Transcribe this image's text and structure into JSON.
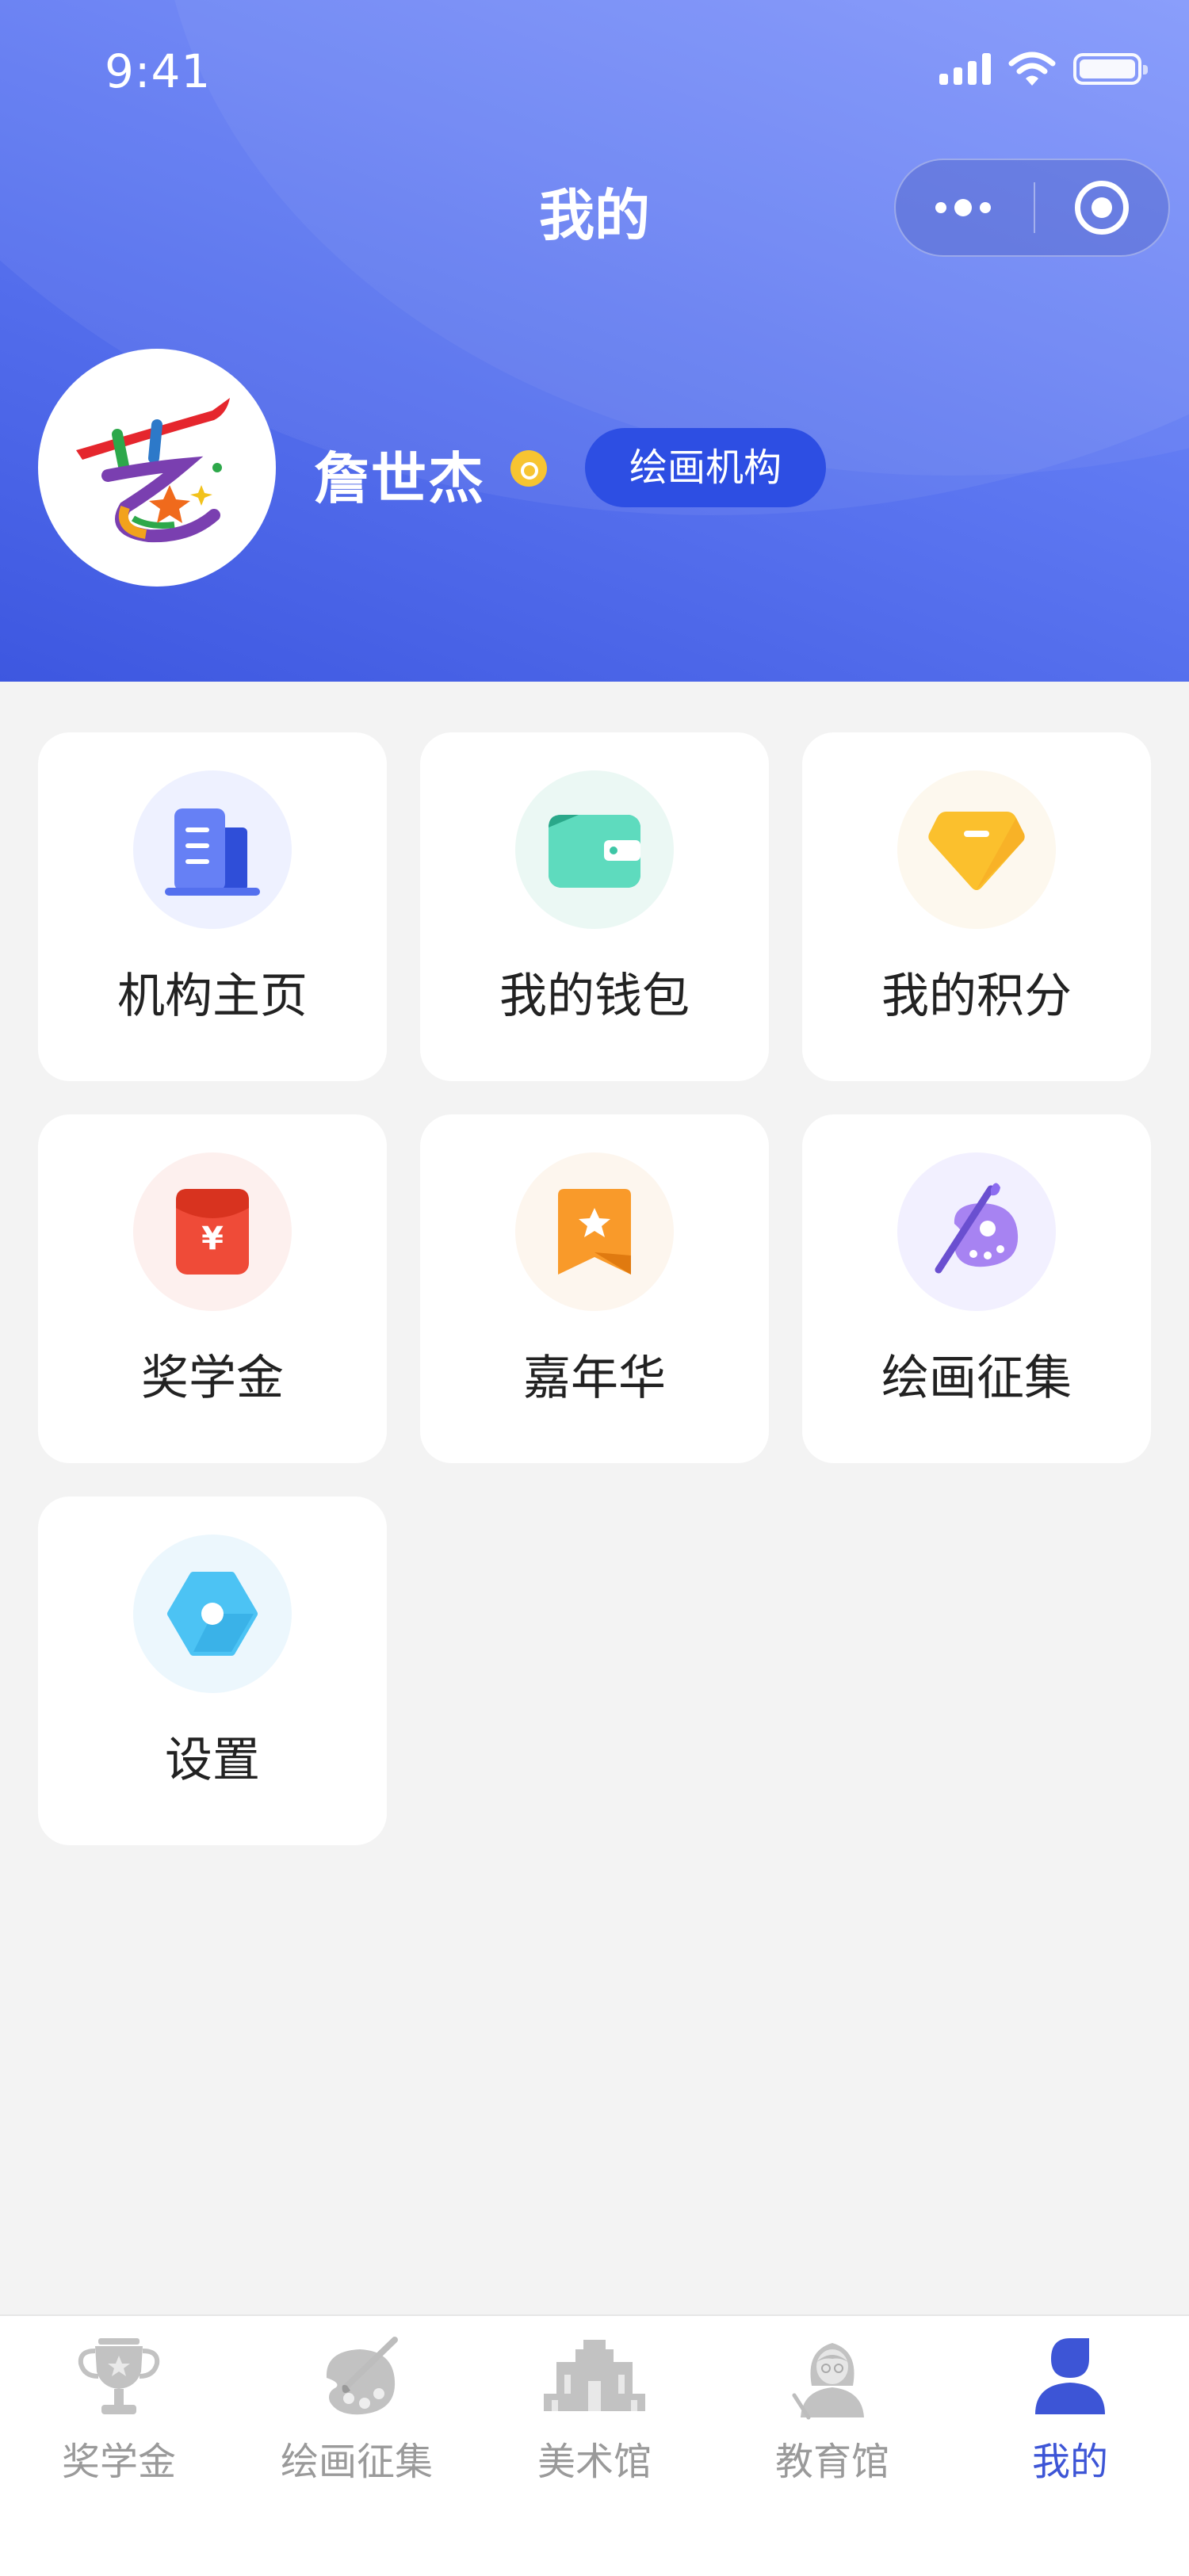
{
  "status_bar": {
    "time": "9:41"
  },
  "header": {
    "title": "我的"
  },
  "profile": {
    "name": "詹世杰",
    "badge": "绘画机构"
  },
  "menu": [
    {
      "label": "机构主页",
      "icon": "building-icon"
    },
    {
      "label": "我的钱包",
      "icon": "wallet-icon"
    },
    {
      "label": "我的积分",
      "icon": "diamond-icon"
    },
    {
      "label": "奖学金",
      "icon": "red-envelope-icon"
    },
    {
      "label": "嘉年华",
      "icon": "star-ribbon-icon"
    },
    {
      "label": "绘画征集",
      "icon": "palette-icon"
    },
    {
      "label": "设置",
      "icon": "hexagon-settings-icon"
    }
  ],
  "tabbar": [
    {
      "label": "奖学金",
      "icon": "trophy-icon",
      "active": false
    },
    {
      "label": "绘画征集",
      "icon": "palette-icon",
      "active": false
    },
    {
      "label": "美术馆",
      "icon": "museum-icon",
      "active": false
    },
    {
      "label": "教育馆",
      "icon": "teacher-icon",
      "active": false
    },
    {
      "label": "我的",
      "icon": "user-icon",
      "active": true
    }
  ],
  "colors": {
    "header": "#5f79f2",
    "accent": "#3d55d6",
    "badge": "#2d4ee3"
  }
}
